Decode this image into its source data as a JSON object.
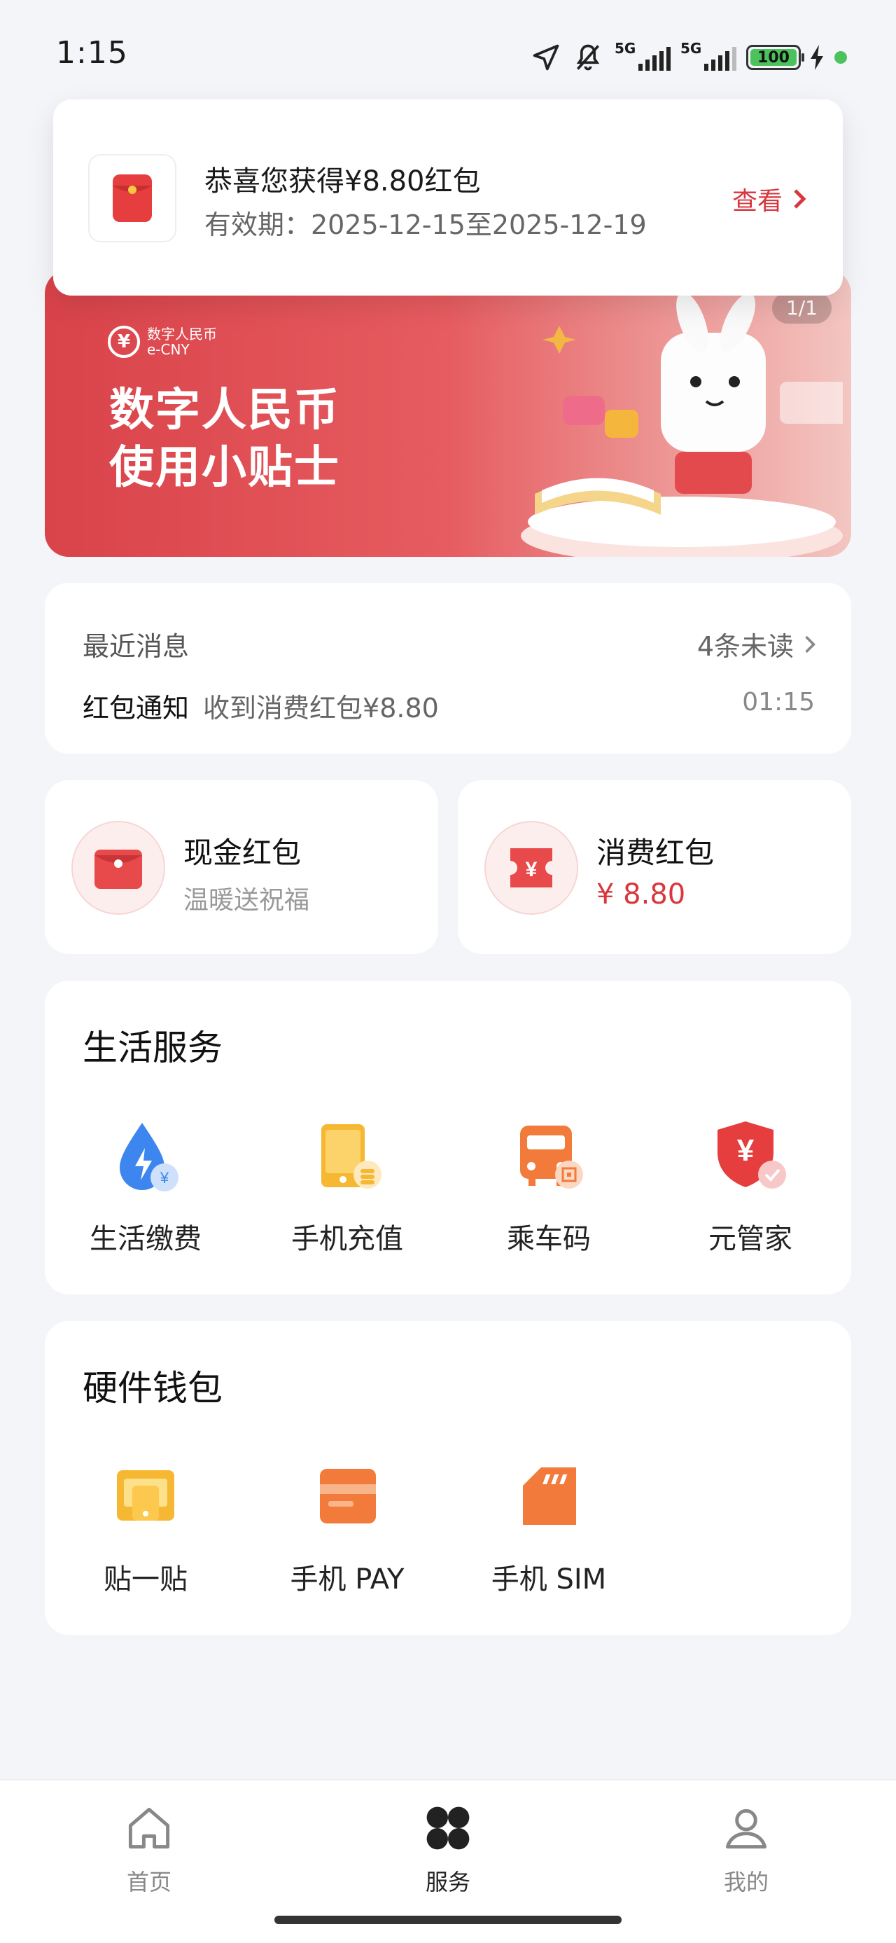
{
  "status_bar": {
    "time": "1:15",
    "battery": "100",
    "net1": "5G",
    "net2": "5G"
  },
  "banner": {
    "logo_cn": "数字人民币",
    "logo_en": "e-CNY",
    "title_line1": "数字人民币",
    "title_line2": "使用小贴士",
    "counter": "1/1"
  },
  "notification": {
    "title": "恭喜您获得¥8.80红包",
    "validity": "有效期：2025-12-15至2025-12-19",
    "action": "查看"
  },
  "messages": {
    "header": "最近消息",
    "unread": "4条未读",
    "item_type": "红包通知",
    "item_content": "收到消费红包¥8.80",
    "item_time": "01:15"
  },
  "red_packets": {
    "cash_title": "现金红包",
    "cash_sub": "温暖送祝福",
    "consume_title": "消费红包",
    "consume_amount": "¥ 8.80"
  },
  "life_services": {
    "title": "生活服务",
    "items": [
      {
        "label": "生活缴费",
        "icon": "bill-pay-icon"
      },
      {
        "label": "手机充值",
        "icon": "phone-topup-icon"
      },
      {
        "label": "乘车码",
        "icon": "transit-code-icon"
      },
      {
        "label": "元管家",
        "icon": "yuan-guard-icon"
      }
    ]
  },
  "hardware_wallet": {
    "title": "硬件钱包",
    "items": [
      {
        "label": "贴一贴",
        "icon": "tap-icon"
      },
      {
        "label": "手机 PAY",
        "icon": "phone-pay-icon"
      },
      {
        "label": "手机 SIM",
        "icon": "sim-card-icon"
      }
    ]
  },
  "bottom_nav": {
    "home": "首页",
    "services": "服务",
    "mine": "我的",
    "active": "services"
  },
  "colors": {
    "accent_red": "#d9363e",
    "background": "#f4f5f8"
  }
}
